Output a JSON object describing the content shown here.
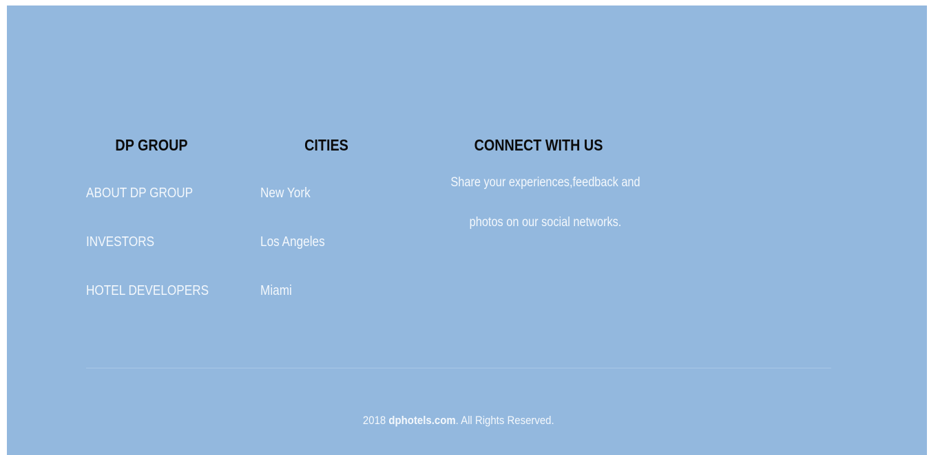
{
  "footer": {
    "columns": [
      {
        "heading": "DP GROUP",
        "links": [
          "ABOUT DP GROUP",
          "INVESTORS",
          "HOTEL DEVELOPERS"
        ]
      },
      {
        "heading": "CITIES",
        "links": [
          "New York",
          "Los Angeles",
          "Miami"
        ]
      },
      {
        "heading": "CONNECT WITH US",
        "text_line1": "Share your experiences,feedback and",
        "text_line2": "photos on our social networks."
      }
    ],
    "copyright": {
      "year": "2018",
      "site": "dphotels.com",
      "suffix": ". All Rights Reserved."
    },
    "colors": {
      "background": "#93b8de",
      "heading": "#0b0b0b",
      "link": "#f4f8fc",
      "divider": "#a9c7e6"
    }
  }
}
